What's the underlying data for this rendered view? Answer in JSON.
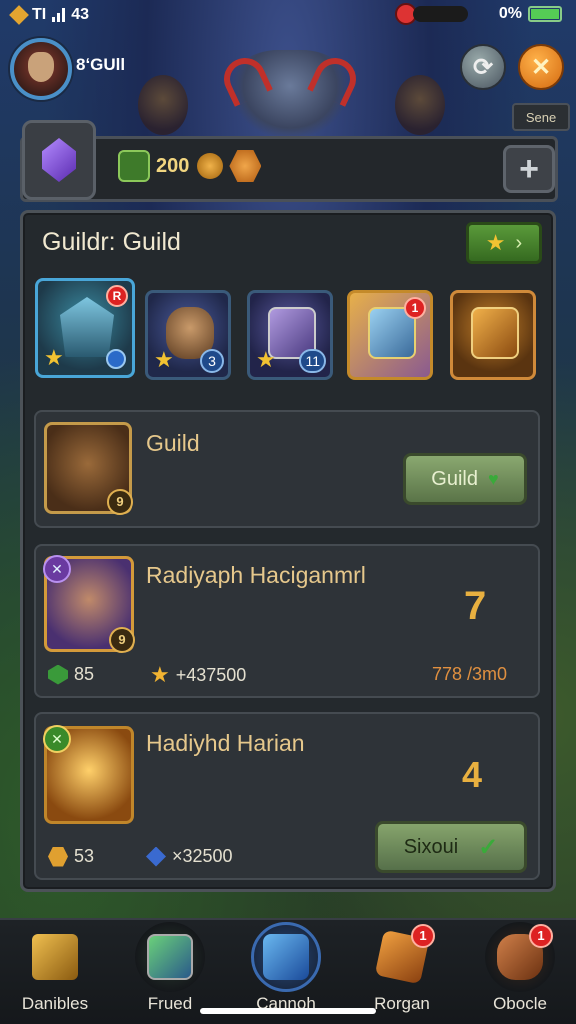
{
  "status_bar": {
    "carrier": "TI",
    "time": "43",
    "battery": "0%"
  },
  "header": {
    "player_name": "8ʻGUll",
    "tag_label": "Sene"
  },
  "currency": {
    "value": "200"
  },
  "panel": {
    "title": "Guildr: Guild",
    "slots": [
      {
        "name": "slot-1",
        "badge": "R",
        "star": true
      },
      {
        "name": "slot-2",
        "count": "3",
        "star": true
      },
      {
        "name": "slot-3",
        "count": "11",
        "star": true
      },
      {
        "name": "slot-4",
        "badge": "1"
      },
      {
        "name": "slot-5"
      }
    ]
  },
  "cards": [
    {
      "title": "Guild",
      "icon_badge": "9",
      "button_label": "Guild"
    },
    {
      "title": "Radiyaph Haciganmrl",
      "icon_badge": "9",
      "rank": "7",
      "stat1": "85",
      "stat2": "+437500",
      "ratio": "778 /3m0"
    },
    {
      "title": "Hadiyhd Harian",
      "rank": "4",
      "stat1": "53",
      "stat2": "×32500",
      "button_label": "Sixoui"
    }
  ],
  "bottom_nav": [
    {
      "label": "Danibles"
    },
    {
      "label": "Frued"
    },
    {
      "label": "Cannoh"
    },
    {
      "label": "Rorgan",
      "badge": "1"
    },
    {
      "label": "Obocle",
      "badge": "1"
    }
  ],
  "colors": {
    "accent_gold": "#e8b040",
    "panel_bg": "#24292d",
    "button_green": "#8aa870"
  }
}
